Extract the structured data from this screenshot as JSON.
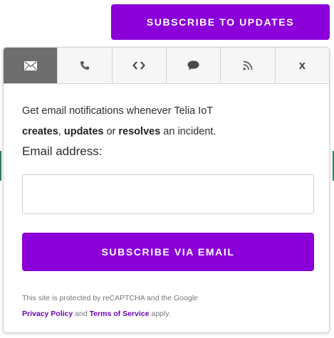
{
  "header": {
    "subscribe_updates_label": "SUBSCRIBE TO UPDATES"
  },
  "tabs": [
    {
      "icon": "envelope-icon",
      "active": true
    },
    {
      "icon": "phone-icon",
      "active": false
    },
    {
      "icon": "code-icon",
      "active": false
    },
    {
      "icon": "chat-bubble-icon",
      "active": false
    },
    {
      "icon": "rss-icon",
      "active": false
    },
    {
      "icon": "close-icon",
      "label": "x",
      "active": false
    }
  ],
  "form": {
    "desc_prefix": "Get email notifications whenever Telia IoT",
    "desc_creates": "creates",
    "desc_comma": ", ",
    "desc_updates": "updates",
    "desc_or": " or ",
    "desc_resolves": "resolves",
    "desc_suffix": " an incident.",
    "email_label": "Email address:",
    "email_value": "",
    "email_placeholder": "",
    "submit_label": "SUBSCRIBE VIA EMAIL"
  },
  "legal": {
    "text_prefix": "This site is protected by reCAPTCHA and the Google",
    "privacy_label": "Privacy Policy",
    "and_text": " and ",
    "terms_label": "Terms of Service",
    "suffix_text": " apply."
  },
  "colors": {
    "brand_purple": "#8b00d8",
    "active_tab": "#6e6e6e",
    "link_purple": "#6a00b5"
  }
}
